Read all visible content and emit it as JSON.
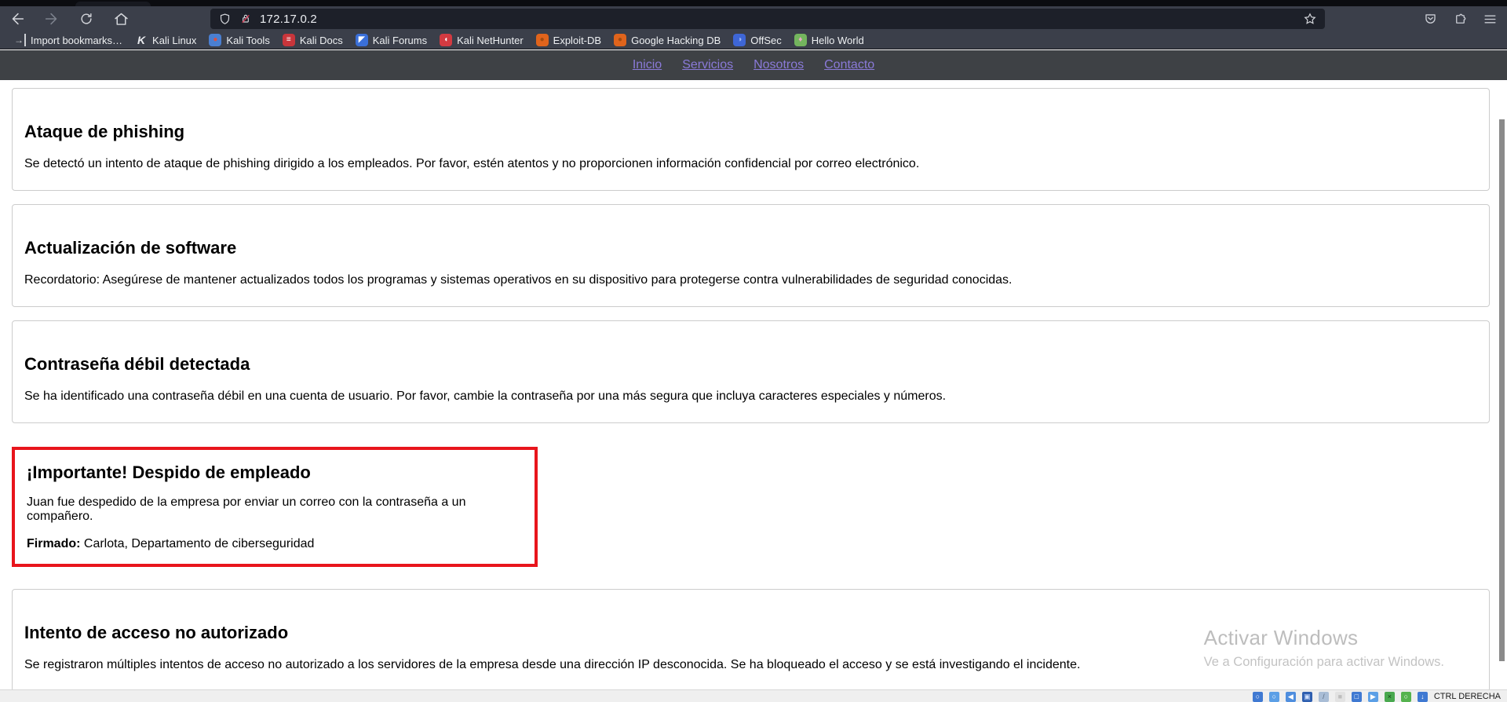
{
  "browser": {
    "url": "172.17.0.2",
    "bookmarks": [
      {
        "name": "bookmark-import",
        "icon": "import-bookmarks-icon",
        "label": "Import bookmarks…",
        "glyph": "→",
        "icon_color": "transparent",
        "glyph_color": "#cfd1d6"
      },
      {
        "name": "bookmark-kali-linux",
        "icon": "kali-linux-icon",
        "label": "Kali Linux",
        "glyph": "K",
        "icon_color": "transparent",
        "glyph_color": "#e8eaee"
      },
      {
        "name": "bookmark-kali-tools",
        "icon": "kali-tools-icon",
        "label": "Kali Tools",
        "glyph": "●",
        "icon_color": "#4a7fd1",
        "glyph_color": "#d94f43"
      },
      {
        "name": "bookmark-kali-docs",
        "icon": "kali-docs-icon",
        "label": "Kali Docs",
        "glyph": "≡",
        "icon_color": "#c8353b",
        "glyph_color": "#ffffff"
      },
      {
        "name": "bookmark-kali-forums",
        "icon": "kali-forums-icon",
        "label": "Kali Forums",
        "glyph": "◤",
        "icon_color": "#3a6fd8",
        "glyph_color": "#ffffff"
      },
      {
        "name": "bookmark-kali-nethunter",
        "icon": "kali-nethunter-icon",
        "label": "Kali NetHunter",
        "glyph": "◖",
        "icon_color": "#d33a41",
        "glyph_color": "#ffffff"
      },
      {
        "name": "bookmark-exploit-db",
        "icon": "exploit-db-icon",
        "label": "Exploit-DB",
        "glyph": "●",
        "icon_color": "#e0641c",
        "glyph_color": "#a34c10"
      },
      {
        "name": "bookmark-google-hacking-db",
        "icon": "google-hacking-db-icon",
        "label": "Google Hacking DB",
        "glyph": "●",
        "icon_color": "#e0641c",
        "glyph_color": "#a34c10"
      },
      {
        "name": "bookmark-offsec",
        "icon": "offsec-icon",
        "label": "OffSec",
        "glyph": "◑",
        "icon_color": "#3e66d6",
        "glyph_color": "#9db8f5"
      },
      {
        "name": "bookmark-hello-world",
        "icon": "hello-world-icon",
        "label": "Hello World",
        "glyph": "♦",
        "icon_color": "#74b55e",
        "glyph_color": "#e7a9c4"
      }
    ]
  },
  "page": {
    "nav_links": [
      {
        "name": "nav-link-inicio",
        "label": "Inicio"
      },
      {
        "name": "nav-link-servicios",
        "label": "Servicios"
      },
      {
        "name": "nav-link-nosotros",
        "label": "Nosotros"
      },
      {
        "name": "nav-link-contacto",
        "label": "Contacto"
      }
    ],
    "notices": [
      {
        "name": "notice-phishing",
        "title": "Ataque de phishing",
        "body": "Se detectó un intento de ataque de phishing dirigido a los empleados. Por favor, estén atentos y no proporcionen información confidencial por correo electrónico.",
        "highlight": false
      },
      {
        "name": "notice-actualizacion",
        "title": "Actualización de software",
        "body": "Recordatorio: Asegúrese de mantener actualizados todos los programas y sistemas operativos en su dispositivo para protegerse contra vulnerabilidades de seguridad conocidas.",
        "highlight": false
      },
      {
        "name": "notice-contrasena",
        "title": "Contraseña débil detectada",
        "body": "Se ha identificado una contraseña débil en una cuenta de usuario. Por favor, cambie la contraseña por una más segura que incluya caracteres especiales y números.",
        "highlight": false
      },
      {
        "name": "notice-despido",
        "title": "¡Importante! Despido de empleado",
        "body": "Juan fue despedido de la empresa por enviar un correo con la contraseña a un compañero.",
        "signed_label": "Firmado:",
        "signed_text": " Carlota, Departamento de ciberseguridad",
        "highlight": true
      },
      {
        "name": "notice-acceso",
        "title": "Intento de acceso no autorizado",
        "body": "Se registraron múltiples intentos de acceso no autorizado a los servidores de la empresa desde una dirección IP desconocida. Se ha bloqueado el acceso y se está investigando el incidente.",
        "highlight": false
      }
    ],
    "watermark": {
      "title": "Activar Windows",
      "subtitle": "Ve a Configuración para activar Windows."
    }
  },
  "vm_bar": {
    "host_key": "CTRL DERECHA",
    "icons": [
      {
        "icon": "hard-disk-icon",
        "color": "#3f79d2",
        "glyph": "○",
        "glyph_color": "#ffffff"
      },
      {
        "icon": "optical-drive-icon",
        "color": "#5b9fe6",
        "glyph": "○",
        "glyph_color": "#ffffff"
      },
      {
        "icon": "audio-icon",
        "color": "#4f8ede",
        "glyph": "◀",
        "glyph_color": "#ffffff"
      },
      {
        "icon": "network-icon",
        "color": "#2f5fb0",
        "glyph": "▣",
        "glyph_color": "#cfe0ff"
      },
      {
        "icon": "usb-icon",
        "color": "#a9bdd6",
        "glyph": "/",
        "glyph_color": "#5a6b80"
      },
      {
        "icon": "shared-folders-icon",
        "color": "#e2e2e2",
        "glyph": "■",
        "glyph_color": "#bdbdbd"
      },
      {
        "icon": "display-icon",
        "color": "#3f79d2",
        "glyph": "□",
        "glyph_color": "#ffffff"
      },
      {
        "icon": "recording-icon",
        "color": "#5b9fe6",
        "glyph": "▶",
        "glyph_color": "#ffffff"
      },
      {
        "icon": "features-icon",
        "color": "#49a94f",
        "glyph": "×",
        "glyph_color": "#103d12"
      },
      {
        "icon": "mouse-integration-icon",
        "color": "#55b34e",
        "glyph": "○",
        "glyph_color": "#ffffff"
      },
      {
        "icon": "keyboard-icon",
        "color": "#3f79d2",
        "glyph": "↓",
        "glyph_color": "#ffffff"
      }
    ]
  },
  "colors": {
    "chrome_bg": "#3b3f4a",
    "urlbar_bg": "#1d2029",
    "page_header_bg": "#3e4145",
    "visited_link": "#8a7ad8",
    "alert_border": "#e8151c",
    "watermark_text": "#bdbdbd"
  }
}
